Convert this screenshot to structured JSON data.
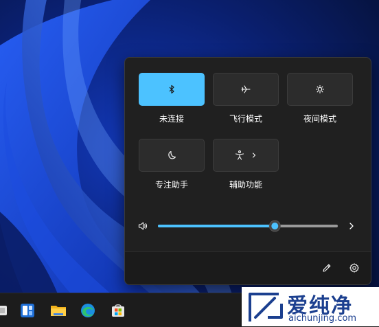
{
  "quick_settings": {
    "tiles": [
      {
        "label": "未连接",
        "icon": "bluetooth-icon",
        "state": "on"
      },
      {
        "label": "飞行模式",
        "icon": "airplane-icon",
        "state": "off"
      },
      {
        "label": "夜间模式",
        "icon": "night-light-icon",
        "state": "off"
      },
      {
        "label": "专注助手",
        "icon": "moon-icon",
        "state": "off"
      },
      {
        "label": "辅助功能",
        "icon": "accessibility-icon",
        "state": "off"
      }
    ],
    "volume": {
      "level": 0.65,
      "icon": "speaker-icon"
    },
    "footer": {
      "edit_icon": "pencil-icon",
      "settings_icon": "gear-icon"
    }
  },
  "taskbar": {
    "apps": [
      "task-view-icon",
      "widgets-icon",
      "file-explorer-icon",
      "edge-icon",
      "store-icon"
    ]
  },
  "watermark": {
    "title": "爱纯净",
    "url": "aichunjing.com"
  },
  "colors": {
    "accent": "#4cc2ff",
    "panel": "#202020",
    "tile": "#2c2c2c"
  }
}
